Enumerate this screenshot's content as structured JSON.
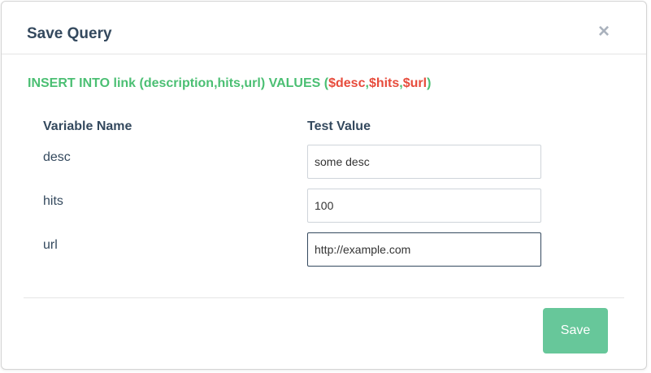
{
  "modal": {
    "title": "Save Query",
    "close_label": "×"
  },
  "query": {
    "prefix": "INSERT INTO link (description,hits,url) VALUES (",
    "vars": [
      "$desc",
      "$hits",
      "$url"
    ],
    "separator": ",",
    "suffix": ")"
  },
  "table": {
    "headers": {
      "variable": "Variable Name",
      "test_value": "Test Value"
    },
    "rows": [
      {
        "name": "desc",
        "value": "some desc"
      },
      {
        "name": "hits",
        "value": "100"
      },
      {
        "name": "url",
        "value": "http://example.com"
      }
    ]
  },
  "footer": {
    "save_label": "Save"
  },
  "colors": {
    "query_green": "#4bbf73",
    "query_red": "#e74c3c",
    "save_button": "#67c79a",
    "text": "#34495e"
  }
}
